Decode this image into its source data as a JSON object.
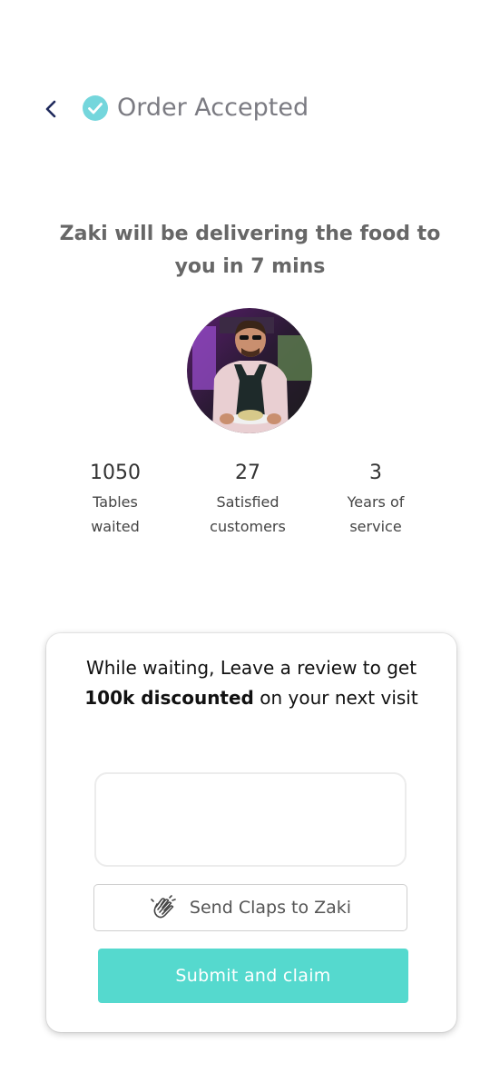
{
  "header": {
    "title": "Order Accepted",
    "back_icon": "chevron-left-icon",
    "status_icon": "check-circle-icon"
  },
  "headline": "Zaki will be delivering the food to you in 7 mins",
  "waiter": {
    "name": "Zaki",
    "avatar_icon": "waiter-avatar"
  },
  "stats": [
    {
      "value": "1050",
      "label": "Tables waited"
    },
    {
      "value": "27",
      "label": "Satisfied customers"
    },
    {
      "value": "3",
      "label": "Years of service"
    }
  ],
  "review": {
    "prompt_before": "While waiting, Leave a review to get ",
    "prompt_bold": "100k discounted",
    "prompt_after": " on your next visit",
    "input_value": "",
    "claps_icon": "clapping-hands-icon",
    "claps_label": "Send Claps to Zaki",
    "submit_label": "Submit and claim"
  },
  "colors": {
    "accent": "#55d9ce",
    "title_text": "#7b7b82",
    "back_icon": "#1f2a5c"
  }
}
